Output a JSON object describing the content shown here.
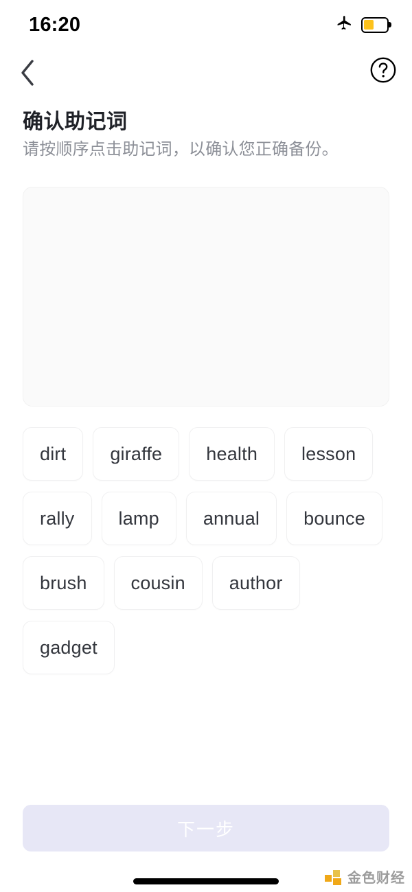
{
  "status_bar": {
    "time": "16:20",
    "airplane_icon": "airplane-mode-icon",
    "battery_icon": "battery-low-power-icon",
    "battery_level_percent": 40,
    "battery_fill_color": "#fdc21c"
  },
  "nav_bar": {
    "back_icon": "chevron-left-icon",
    "help_icon": "question-mark-circle-icon"
  },
  "page": {
    "title": "确认助记词",
    "subtitle": "请按顺序点击助记词，以确认您正确备份。"
  },
  "answer_area": {
    "selected_words": [],
    "background_color": "#fafafa"
  },
  "word_pool": {
    "words": [
      "dirt",
      "giraffe",
      "health",
      "lesson",
      "rally",
      "lamp",
      "annual",
      "bounce",
      "brush",
      "cousin",
      "author",
      "gadget"
    ]
  },
  "footer": {
    "next_label": "下一步",
    "next_disabled": true,
    "next_background_color": "#e7e7f6",
    "next_text_color": "#ffffff"
  },
  "watermark": {
    "text": "金色财经",
    "logo_color": "#f0a818"
  }
}
